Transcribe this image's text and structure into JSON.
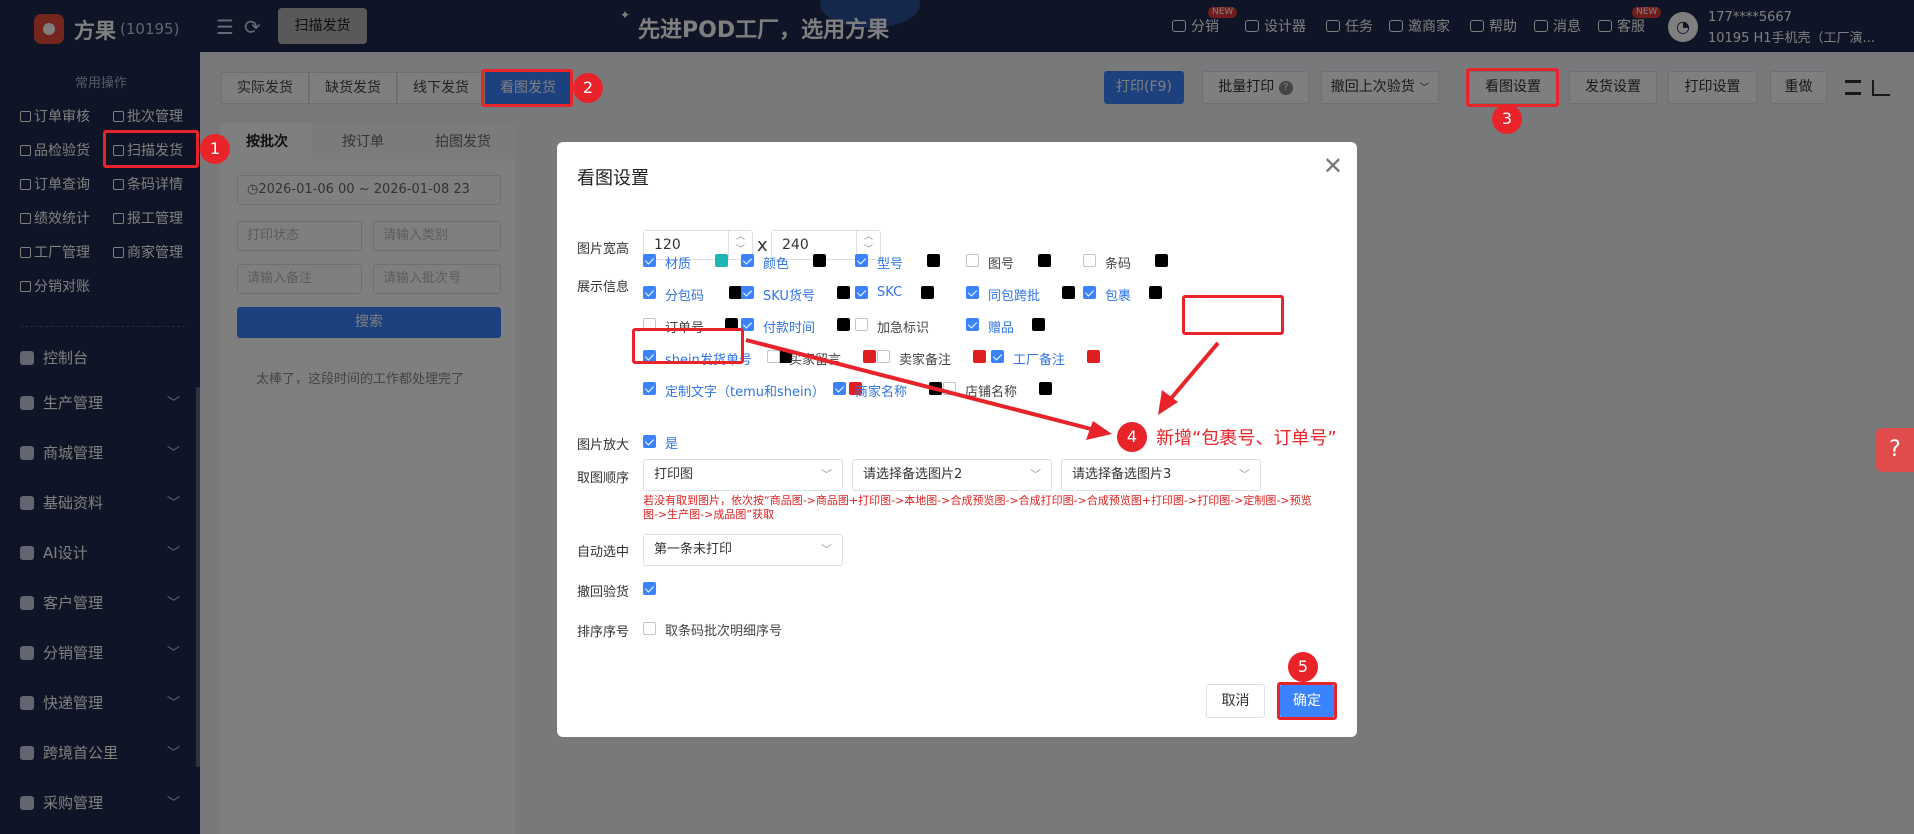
{
  "header": {
    "brand": "方果",
    "count": "(10195)",
    "scan_tab": "扫描发货",
    "slogan": "先进POD工厂，选用方果",
    "nav": [
      {
        "label": "分销",
        "badge": "NEW"
      },
      {
        "label": "设计器"
      },
      {
        "label": "任务"
      },
      {
        "label": "邀商家"
      },
      {
        "label": "帮助"
      },
      {
        "label": "消息"
      },
      {
        "label": "客服",
        "badge": "NEW"
      }
    ],
    "user": {
      "name": "177****5667",
      "company": "10195 H1手机壳（工厂演..."
    }
  },
  "sidebar": {
    "quick_title": "常用操作",
    "quick_items": [
      "订单审核",
      "批次管理",
      "品检验货",
      "扫描发货",
      "订单查询",
      "条码详情",
      "绩效统计",
      "报工管理",
      "工厂管理",
      "商家管理",
      "分销对账"
    ],
    "menus": [
      "控制台",
      "生产管理",
      "商城管理",
      "基础资料",
      "AI设计",
      "客户管理",
      "分销管理",
      "快递管理",
      "跨境首公里",
      "采购管理"
    ]
  },
  "tabs": [
    "实际发货",
    "缺货发货",
    "线下发货",
    "看图发货"
  ],
  "toolbar": {
    "print": "打印(F9)",
    "batch_print": "批量打印",
    "undo": "撤回上次验货",
    "view_settings": "看图设置",
    "ship_settings": "发货设置",
    "print_settings": "打印设置",
    "reset": "重做"
  },
  "left_panel": {
    "subtabs": [
      "按批次",
      "按订单",
      "拍图发货"
    ],
    "date_range": "2026-01-06 00 ~ 2026-01-08 23",
    "print_status_ph": "打印状态",
    "category_ph": "请输入类别",
    "remark_ph": "请输入备注",
    "batch_ph": "请输入批次号",
    "search": "搜索",
    "done_msg": "太棒了，这段时间的工作都处理完了"
  },
  "modal": {
    "title": "看图设置",
    "size_label": "图片宽高",
    "width": "120",
    "height": "240",
    "times": "x",
    "display_label": "展示信息",
    "display_items": [
      {
        "label": "材质",
        "checked": true,
        "color": "#1fb5b0"
      },
      {
        "label": "颜色",
        "checked": true,
        "color": "#000000"
      },
      {
        "label": "型号",
        "checked": true,
        "color": "#000000"
      },
      {
        "label": "图号",
        "checked": false,
        "color": "#000000"
      },
      {
        "label": "条码",
        "checked": false,
        "color": "#000000"
      },
      {
        "label": "分包码",
        "checked": true,
        "color": "#000000"
      },
      {
        "label": "SKU货号",
        "checked": true,
        "color": "#000000"
      },
      {
        "label": "SKC",
        "checked": true,
        "color": "#000000"
      },
      {
        "label": "同包跨批",
        "checked": true,
        "color": "#000000"
      },
      {
        "label": "包裹",
        "checked": true,
        "color": "#000000"
      },
      {
        "label": "订单号",
        "checked": false,
        "color": "#000000"
      },
      {
        "label": "付款时间",
        "checked": true,
        "color": "#000000"
      },
      {
        "label": "加急标识",
        "checked": false,
        "color": ""
      },
      {
        "label": "赠品",
        "checked": true,
        "color": "#000000"
      },
      {
        "label": "shein发货单号",
        "checked": true,
        "color": "#000000"
      },
      {
        "label": "买家留言",
        "checked": false,
        "color": "#e02020"
      },
      {
        "label": "卖家备注",
        "checked": false,
        "color": "#e02020"
      },
      {
        "label": "工厂备注",
        "checked": true,
        "color": "#e02020"
      },
      {
        "label": "定制文字（temu和shein）",
        "checked": true,
        "color": "#e02020"
      },
      {
        "label": "商家名称",
        "checked": true,
        "color": "#000000"
      },
      {
        "label": "店铺名称",
        "checked": false,
        "color": "#000000"
      }
    ],
    "zoom_label": "图片放大",
    "zoom_value": "是",
    "order_label": "取图顺序",
    "order_1": "打印图",
    "order_2_ph": "请选择备选图片2",
    "order_3_ph": "请选择备选图片3",
    "hint": "若没有取到图片，依次按“商品图->商品图+打印图->本地图->合成预览图->合成打印图->合成预览图+打印图->打印图->定制图->预览图->生产图->成品图”获取",
    "auto_label": "自动选中",
    "auto_value": "第一条未打印",
    "undo_label": "撤回验货",
    "seq_label": "排序序号",
    "seq_option": "取条码批次明细序号",
    "cancel": "取消",
    "ok": "确定"
  },
  "annotations": {
    "n1": "1",
    "n2": "2",
    "n3": "3",
    "n4": "4",
    "n5": "5",
    "note4": "新增“包裹号、订单号”"
  }
}
